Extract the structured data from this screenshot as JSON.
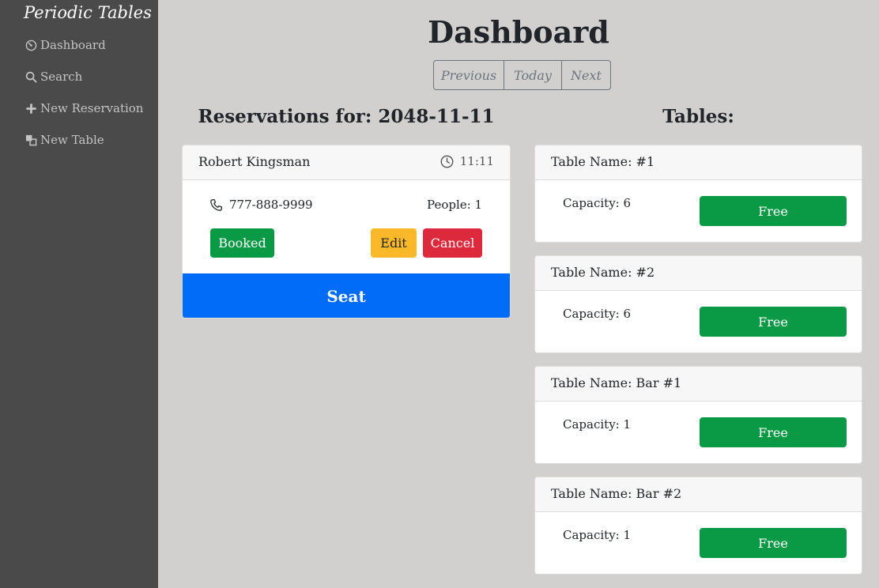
{
  "sidebar": {
    "brand": "Periodic Tables",
    "items": [
      {
        "label": "Dashboard",
        "icon": "dashboard-icon"
      },
      {
        "label": "Search",
        "icon": "search-icon"
      },
      {
        "label": "New Reservation",
        "icon": "plus-icon"
      },
      {
        "label": "New Table",
        "icon": "table-icon"
      }
    ]
  },
  "main": {
    "title": "Dashboard",
    "date_nav": {
      "previous": "Previous",
      "today": "Today",
      "next": "Next"
    },
    "reservations_heading": "Reservations for: 2048-11-11",
    "tables_heading": "Tables:"
  },
  "reservations": [
    {
      "name": "Robert Kingsman",
      "time": "11:11",
      "phone": "777-888-9999",
      "people": "People: 1",
      "status": "Booked",
      "edit_label": "Edit",
      "cancel_label": "Cancel",
      "seat_label": "Seat"
    }
  ],
  "tables": [
    {
      "name": "Table Name: #1",
      "capacity": "Capacity: 6",
      "status": "Free"
    },
    {
      "name": "Table Name: #2",
      "capacity": "Capacity: 6",
      "status": "Free"
    },
    {
      "name": "Table Name: Bar #1",
      "capacity": "Capacity: 1",
      "status": "Free"
    },
    {
      "name": "Table Name: Bar #2",
      "capacity": "Capacity: 1",
      "status": "Free"
    }
  ],
  "colors": {
    "sidebar_bg": "#4a4a4a",
    "page_bg": "#d1d0cf",
    "success": "#0a9a45",
    "warning": "#fbb829",
    "danger": "#dc2a3c",
    "primary": "#006cf7"
  }
}
